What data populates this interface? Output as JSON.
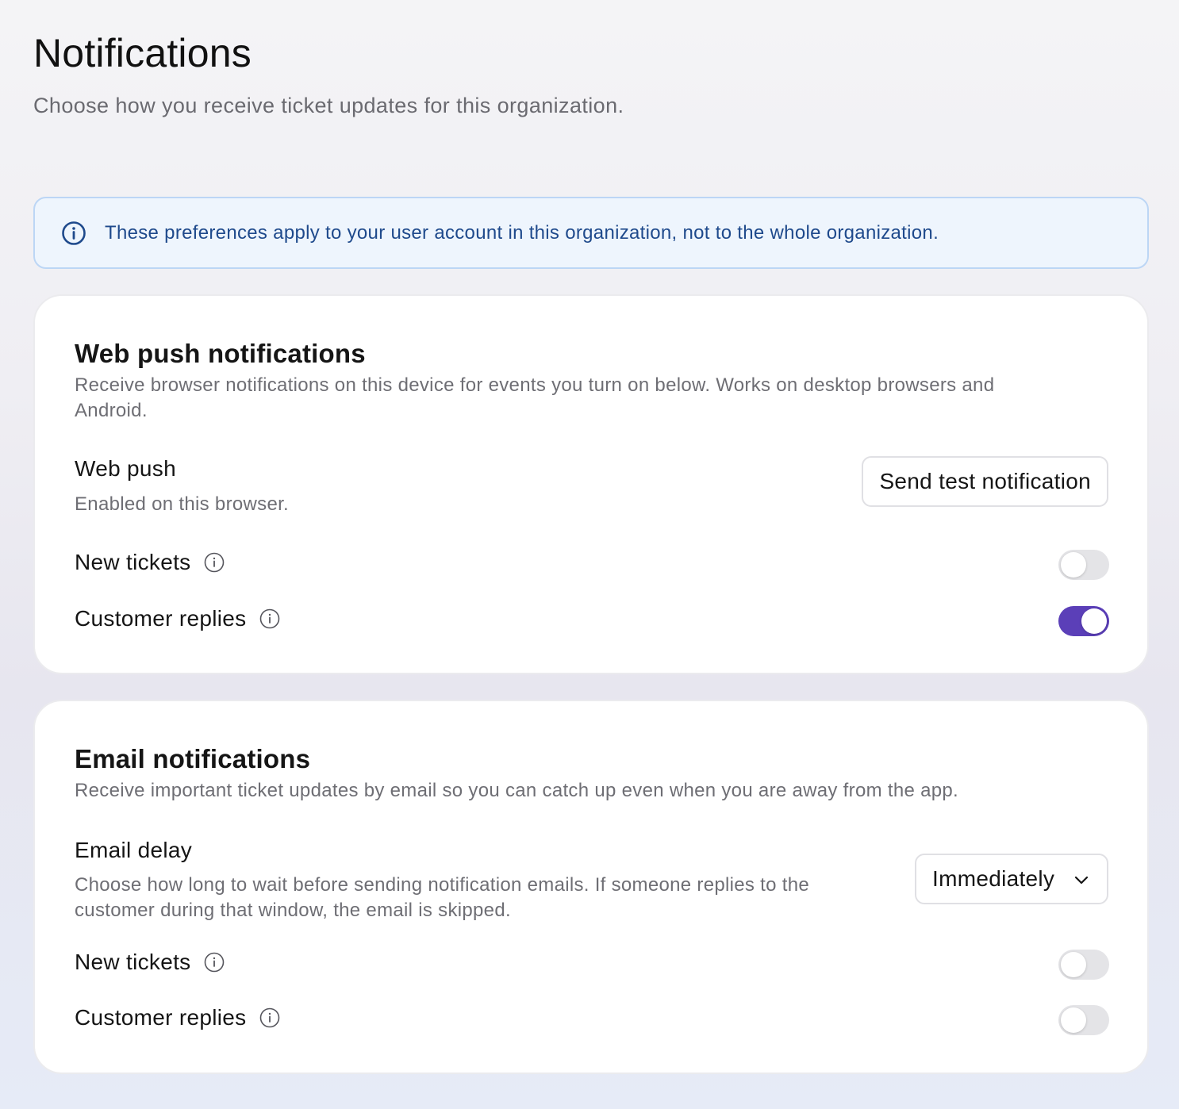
{
  "header": {
    "title": "Notifications",
    "subtitle": "Choose how you receive ticket updates for this organization."
  },
  "banner": {
    "icon": "info-circle-icon",
    "text": "These preferences apply to your user account in this organization, not to the whole organization."
  },
  "web_push": {
    "title": "Web push notifications",
    "description": "Receive browser notifications on this device for events you turn on below. Works on desktop browsers and Android.",
    "status_label": "Web push",
    "status_text": "Enabled on this browser.",
    "test_button": "Send test notification",
    "events": [
      {
        "label": "New tickets",
        "enabled": false
      },
      {
        "label": "Customer replies",
        "enabled": true
      }
    ]
  },
  "email": {
    "title": "Email notifications",
    "description": "Receive important ticket updates by email so you can catch up even when you are away from the app.",
    "delay_label": "Email delay",
    "delay_description": "Choose how long to wait before sending notification emails. If someone replies to the customer during that window, the email is skipped.",
    "delay_value": "Immediately",
    "events": [
      {
        "label": "New tickets",
        "enabled": false
      },
      {
        "label": "Customer replies",
        "enabled": false
      }
    ]
  },
  "colors": {
    "accent": "#5b3fb8",
    "banner_bg": "#eef5fd",
    "banner_border": "#bcd6f5",
    "banner_text": "#1f4a8c"
  }
}
